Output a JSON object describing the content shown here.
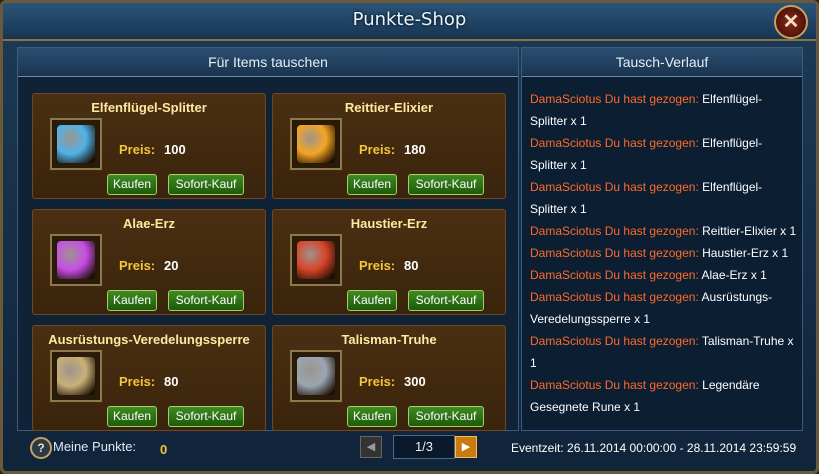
{
  "window": {
    "title": "Punkte-Shop",
    "close_label": "✕"
  },
  "left_panel": {
    "title": "Für Items tauschen"
  },
  "right_panel": {
    "title": "Tausch-Verlauf"
  },
  "price_label": "Preis:",
  "buy_label": "Kaufen",
  "instant_label": "Sofort-Kauf",
  "items": [
    {
      "name": "Elfenflügel-Splitter",
      "price": "100",
      "icon": "puzzle-shard-icon",
      "color": "#4fb3e8"
    },
    {
      "name": "Reittier-Elixier",
      "price": "180",
      "icon": "potion-flask-icon",
      "color": "#f5a623"
    },
    {
      "name": "Alae-Erz",
      "price": "20",
      "icon": "purple-ore-icon",
      "color": "#c84ee8"
    },
    {
      "name": "Haustier-Erz",
      "price": "80",
      "icon": "red-ore-icon",
      "color": "#d8452a"
    },
    {
      "name": "Ausrüstungs-Veredelungssperre",
      "price": "80",
      "icon": "padlock-icon",
      "color": "#c9b07a"
    },
    {
      "name": "Talisman-Truhe",
      "price": "300",
      "icon": "treasure-chest-icon",
      "color": "#9aa6b2"
    }
  ],
  "log": [
    {
      "user": "DamaSciotus",
      "action": "Du hast gezogen:",
      "item": "Elfenflügel-",
      "item2": "Splitter x 1"
    },
    {
      "user": "DamaSciotus",
      "action": "Du hast gezogen:",
      "item": "Elfenflügel-",
      "item2": "Splitter x 1"
    },
    {
      "user": "DamaSciotus",
      "action": "Du hast gezogen:",
      "item": "Elfenflügel-",
      "item2": "Splitter x 1"
    },
    {
      "user": "DamaSciotus",
      "action": "Du hast gezogen:",
      "item": "Reittier-Elixier x 1",
      "item2": ""
    },
    {
      "user": "DamaSciotus",
      "action": "Du hast gezogen:",
      "item": "Haustier-Erz  x 1",
      "item2": ""
    },
    {
      "user": "DamaSciotus",
      "action": "Du hast gezogen:",
      "item": "Alae-Erz x 1",
      "item2": ""
    },
    {
      "user": "DamaSciotus",
      "action": "Du hast gezogen:",
      "item": "Ausrüstungs-",
      "item2": "Veredelungssperre x 1"
    },
    {
      "user": "DamaSciotus",
      "action": "Du hast gezogen:",
      "item": "Talisman-Truhe  x",
      "item2": "1"
    },
    {
      "user": "DamaSciotus",
      "action": "Du hast gezogen:",
      "item": "Legendäre",
      "item2": "Gesegnete Rune x 1"
    }
  ],
  "footer": {
    "help_label": "?",
    "points_label": "Meine Punkte:",
    "points_value": "0",
    "page": "1/3",
    "prev_label": "◀",
    "next_label": "▶",
    "event_time": "Eventzeit: 26.11.2014 00:00:00 - 28.11.2014 23:59:59"
  }
}
